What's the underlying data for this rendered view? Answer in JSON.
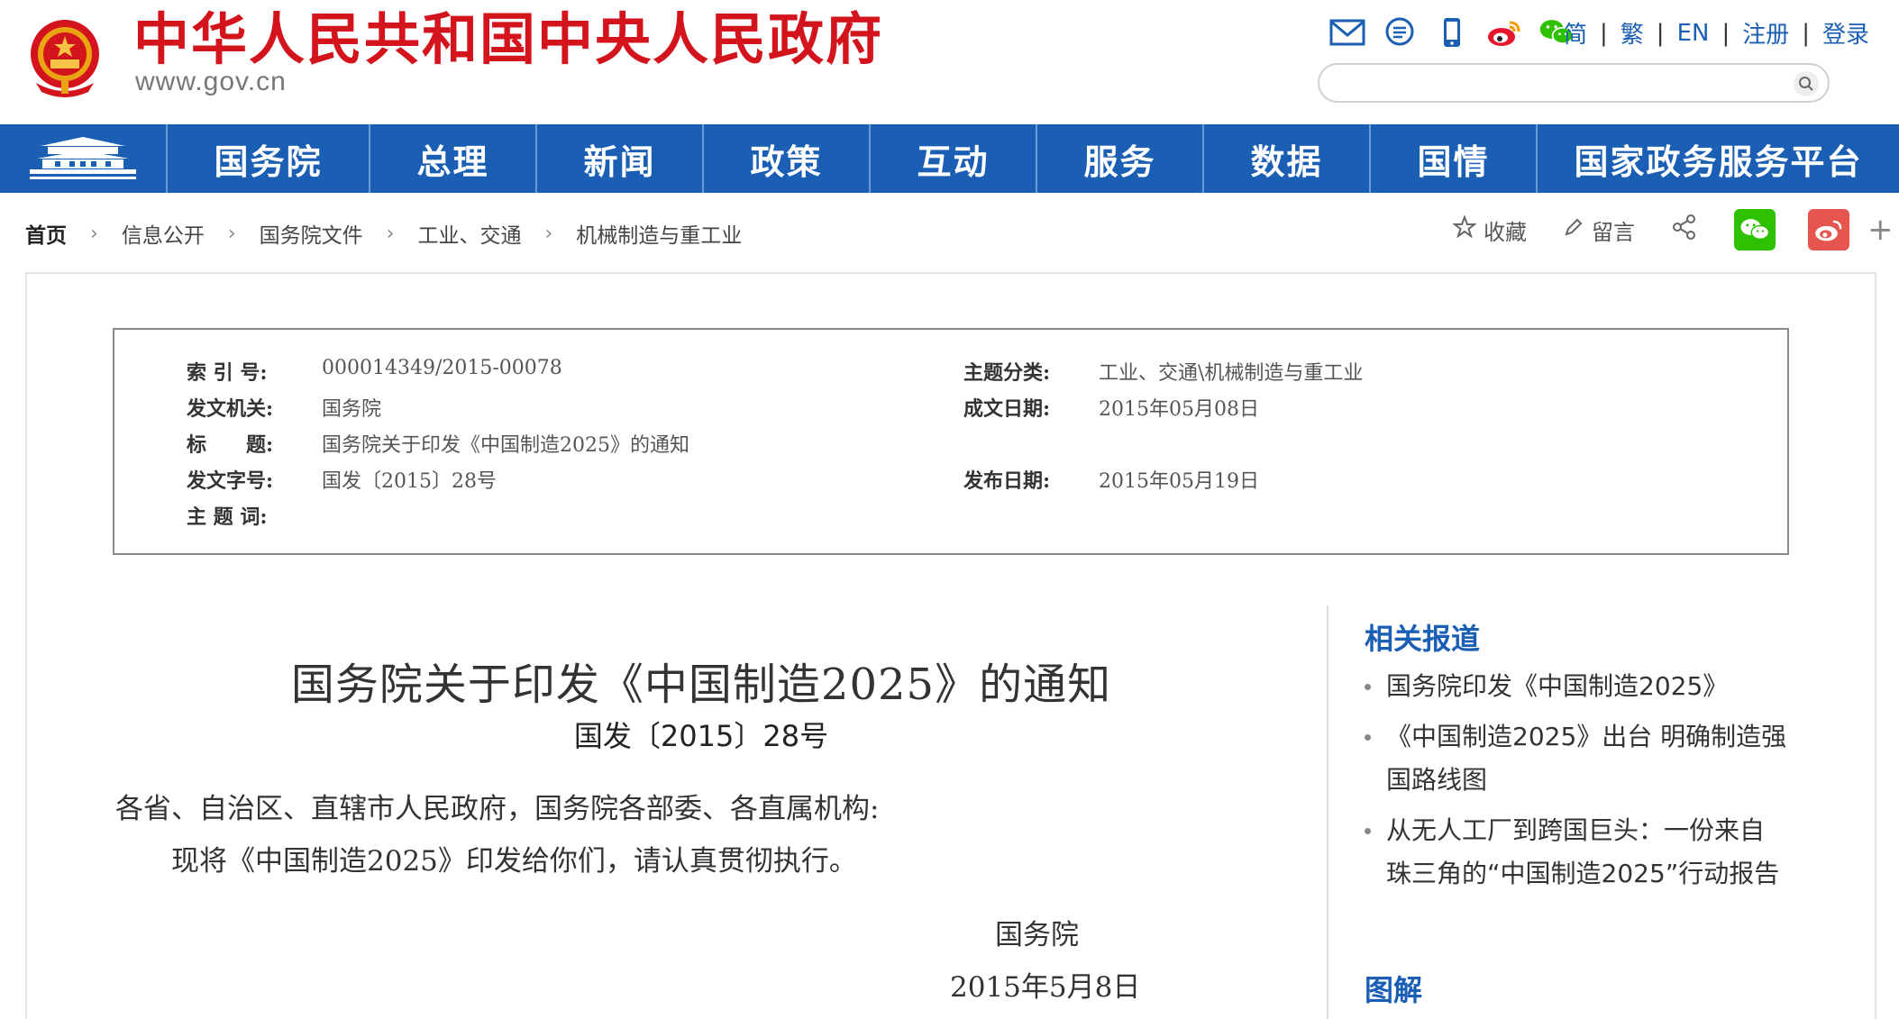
{
  "header": {
    "site_title": "中华人民共和国中央人民政府",
    "site_url": "www.gov.cn",
    "icons": [
      "mail-icon",
      "message-icon",
      "mobile-icon",
      "weibo-icon",
      "wechat-icon"
    ],
    "lang_links": [
      "简",
      "繁",
      "EN",
      "注册",
      "登录"
    ],
    "search_placeholder": ""
  },
  "nav": {
    "items": [
      "国务院",
      "总理",
      "新闻",
      "政策",
      "互动",
      "服务",
      "数据",
      "国情",
      "国家政务服务平台"
    ]
  },
  "breadcrumb": [
    "首页",
    "信息公开",
    "国务院文件",
    "工业、交通",
    "机械制造与重工业"
  ],
  "tools": {
    "favorite": "收藏",
    "comment": "留言"
  },
  "meta": {
    "index_no_label": "索 引 号:",
    "index_no": "000014349/2015-00078",
    "topic_label": "主题分类:",
    "topic": "工业、交通\\机械制造与重工业",
    "issuer_label": "发文机关:",
    "issuer": "国务院",
    "written_date_label": "成文日期:",
    "written_date": "2015年05月08日",
    "title_label": "标　　题:",
    "title": "国务院关于印发《中国制造2025》的通知",
    "doc_no_label": "发文字号:",
    "doc_no": "国发〔2015〕28号",
    "publish_date_label": "发布日期:",
    "publish_date": "2015年05月19日",
    "keywords_label": "主 题 词:",
    "keywords": ""
  },
  "article": {
    "title": "国务院关于印发《中国制造2025》的通知",
    "doc_no": "国发〔2015〕28号",
    "para1": "各省、自治区、直辖市人民政府，国务院各部委、各直属机构:",
    "para2": "现将《中国制造2025》印发给你们，请认真贯彻执行。",
    "signature": "国务院",
    "date": "2015年5月8日"
  },
  "sidebar": {
    "related_heading": "相关报道",
    "related": [
      "国务院印发《中国制造2025》",
      "《中国制造2025》出台 明确制造强国路线图",
      "从无人工厂到跨国巨头：一份来自珠三角的“中国制造2025”行动报告"
    ],
    "graphics_heading": "图解"
  },
  "colors": {
    "brand_red": "#d4141c",
    "nav_blue": "#1a5fb4",
    "wechat_green": "#2dc100",
    "weibo_red": "#e6564f"
  }
}
